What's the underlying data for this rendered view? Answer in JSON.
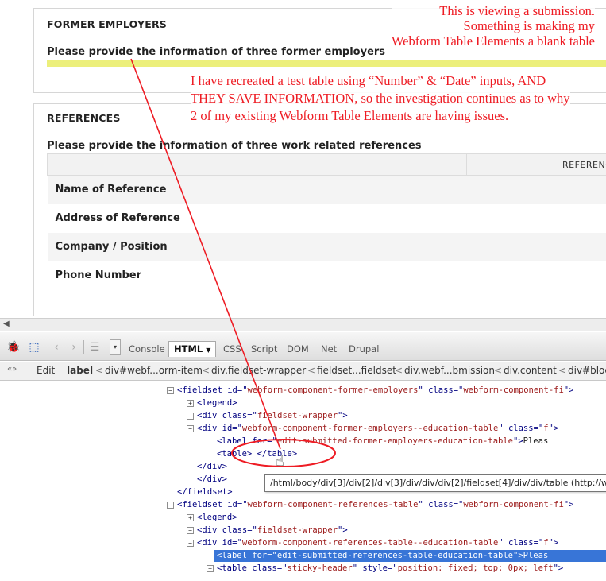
{
  "page": {
    "former_employers": {
      "legend": "FORMER EMPLOYERS",
      "description": "Please provide the information of three former employers"
    },
    "references": {
      "legend": "REFERENCES",
      "description": "Please provide the information of three work related references",
      "table_header": "REFERENC",
      "rows": [
        "Name of Reference",
        "Address of Reference",
        "Company / Position",
        "Phone Number"
      ]
    }
  },
  "annotations": {
    "note1": [
      "This is viewing a submission.",
      "Something is making  my",
      "Webform  Table Elements a blank table"
    ],
    "note2": [
      "I have recreated a test table using “Number” & “Date” inputs, AND",
      "THEY SAVE INFORMATION, so the investigation continues as to why",
      "2 of my existing Webform Table Elements are having issues."
    ],
    "color": "#ee1c24"
  },
  "firebug": {
    "tabs": [
      "Console",
      "HTML",
      "CSS",
      "Script",
      "DOM",
      "Net",
      "Drupal"
    ],
    "active_tab": "HTML",
    "edit_label": "Edit",
    "breadcrumb": [
      "label",
      "div#webf...orm-item",
      "div.fieldset-wrapper",
      "fieldset...fieldset",
      "div.webf...bmission",
      "div.content",
      "div#bloc"
    ],
    "tree": [
      {
        "indent": 0,
        "tag": "fieldset",
        "attrs": [
          [
            "id",
            "webform-component-former-employers"
          ],
          [
            "class",
            "webform-component-fi"
          ]
        ]
      },
      {
        "indent": 1,
        "tag": "legend",
        "collapsed": true
      },
      {
        "indent": 1,
        "tag": "div",
        "attrs": [
          [
            "class",
            "fieldset-wrapper"
          ]
        ]
      },
      {
        "indent": 2,
        "tag": "div",
        "attrs": [
          [
            "id",
            "webform-component-former-employers--education-table"
          ],
          [
            "class",
            "f"
          ]
        ]
      },
      {
        "indent": 3,
        "tag": "label",
        "attrs": [
          [
            "for",
            "edit-submitted-former-employers-education-table"
          ]
        ],
        "text": "Pleas"
      },
      {
        "indent": 3,
        "raw": "<table> </table>"
      },
      {
        "indent": 2,
        "raw": "</div>"
      },
      {
        "indent": 1,
        "raw": "</div>"
      },
      {
        "indent": 0,
        "raw": "</fieldset>"
      },
      {
        "indent": 0,
        "tag": "fieldset",
        "attrs": [
          [
            "id",
            "webform-component-references-table"
          ],
          [
            "class",
            "webform-component-fi"
          ]
        ]
      },
      {
        "indent": 1,
        "tag": "legend",
        "collapsed": true
      },
      {
        "indent": 1,
        "tag": "div",
        "attrs": [
          [
            "class",
            "fieldset-wrapper"
          ]
        ]
      },
      {
        "indent": 2,
        "tag": "div",
        "attrs": [
          [
            "id",
            "webform-component-references-table--education-table"
          ],
          [
            "class",
            "f"
          ]
        ]
      },
      {
        "indent": 3,
        "tag": "label",
        "attrs": [
          [
            "for",
            "edit-submitted-references-table-education-table"
          ]
        ],
        "text": "Pleas",
        "selected": true
      },
      {
        "indent": 3,
        "tag": "table",
        "attrs": [
          [
            "class",
            "sticky-header"
          ],
          [
            "style",
            "position: fixed; top: 0px; left"
          ]
        ],
        "collapsed": true
      }
    ],
    "tooltip": "/html/body/div[3]/div[2]/div[3]/div/div/div[2]/fieldset[4]/div/div/table (http://w"
  }
}
